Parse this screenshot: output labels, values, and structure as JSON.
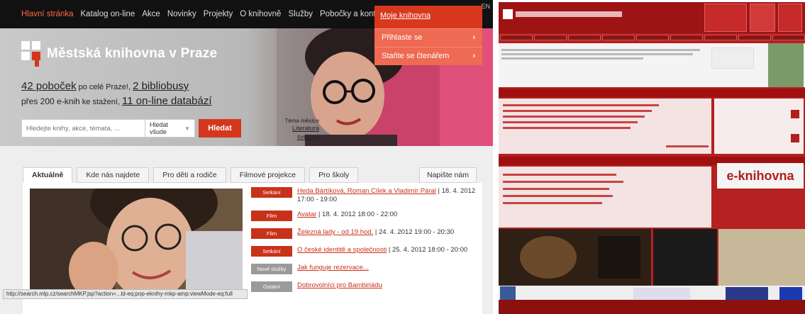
{
  "nav": {
    "items": [
      "Hlavní stránka",
      "Katalog on-line",
      "Akce",
      "Novinky",
      "Projekty",
      "O knihovně",
      "Služby",
      "Pobočky a kontakty"
    ],
    "lang": "EN"
  },
  "my_library": {
    "title": "Moje knihovna",
    "items": [
      "Přihlaste se",
      "Staňte se čtenářem"
    ]
  },
  "hero": {
    "logo_text": "Městská knihovna v Praze",
    "stat1_num": "42 poboček",
    "stat1_txt": " po celé Praze!, ",
    "stat2_num": "2 bibliobusy",
    "stat3_pre": "přes 200 e-knih",
    "stat3_txt": " ke stažení, ",
    "stat4_num": "11 on-line databází",
    "search_placeholder": "Hledejte knihy, akce, témata, ...",
    "select_value": "Hledat všude",
    "search_button": "Hledat",
    "theme_label": "Téma měsíce",
    "theme_value": "Literatura světová"
  },
  "tabs": [
    "Aktuálně",
    "Kde nás najdete",
    "Pro děti a rodiče",
    "Filmové projekce",
    "Pro školy"
  ],
  "write_us": "Napište nám",
  "events": [
    {
      "tag": "Setkání",
      "link": "Heda Bártíková, Roman Cílek a Vladimír Páral",
      "rest": " | 18. 4. 2012 17:00 - 19:00",
      "grey": false
    },
    {
      "tag": "Film",
      "link": "Avatar",
      "rest": " | 18. 4. 2012 18:00 - 22:00",
      "grey": false
    },
    {
      "tag": "Film",
      "link": "Železná lady - od 19 hod.",
      "rest": " | 24. 4. 2012 19:00 - 20:30",
      "grey": false
    },
    {
      "tag": "Setkání",
      "link": "O české identitě a společnosti",
      "rest": " | 25. 4. 2012 18:00 - 20:00",
      "grey": false
    },
    {
      "tag": "Nové služby",
      "link": "Jak funguje rezervace...",
      "rest": "",
      "grey": true
    },
    {
      "tag": "Ostatní",
      "link": "Dobrovolníci pro Bambiriádu",
      "rest": "",
      "grey": true
    }
  ],
  "statusbar": "http://search.mlp.cz/searchMKP.jsp?action=...ld-eq:pop-eknihy-mkp-amp:viewMode-eq:full",
  "old_site": {
    "ebook_label": "e-knihovna"
  }
}
